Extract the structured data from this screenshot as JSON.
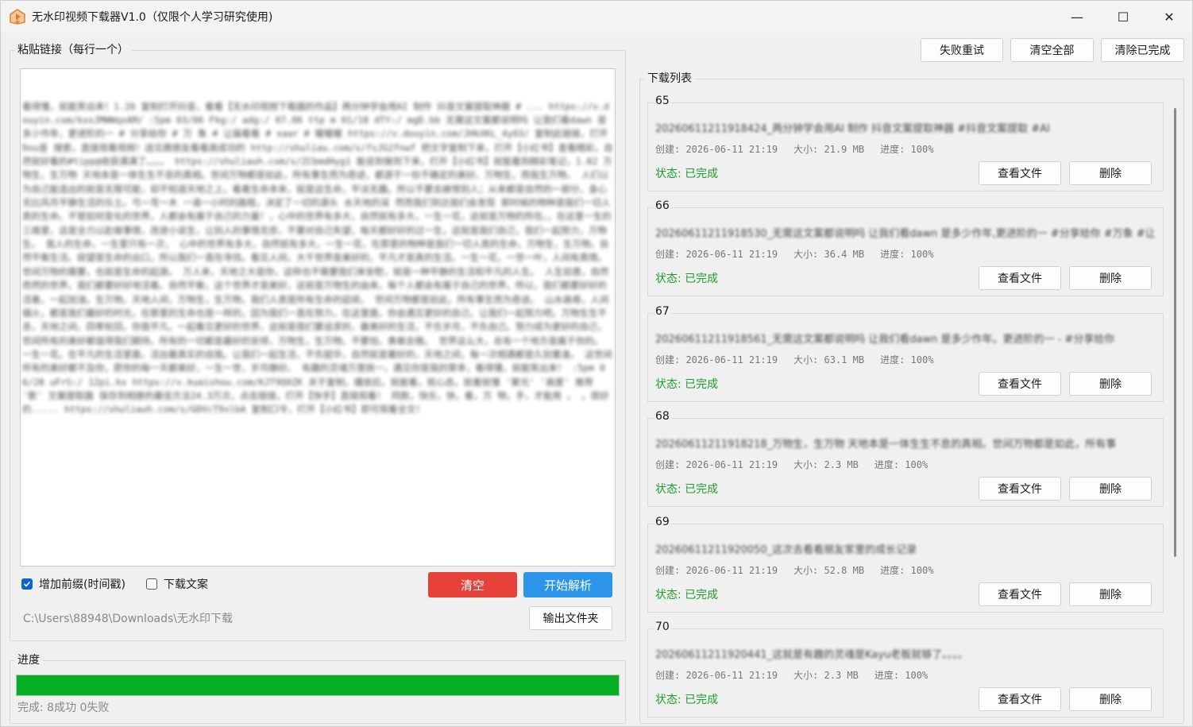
{
  "window": {
    "title": "无水印视频下载器V1.0（仅限个人学习研究使用)",
    "controls": {
      "minimize": "—",
      "maximize": "☐",
      "close": "✕"
    }
  },
  "left": {
    "paste_label": "粘贴链接（每行一个）",
    "paste_text": "看得懂，就能笑出来！1.26 复制打开抖音，看看【无水印视频下载器的作品】两分钟学会用AI 制作 抖音文案提取神器 # ... https://v.douyin.com/kxxJMWWqxAM/ :5pm 03/06 Fkg:/ adg:/ 07.06 ttp m 01/18 dTY:/ mgD.bb 无需这文案都说明吗 让我们看dawn 是多少作年，更进阶的一 # 分享给你 # 万 象 # 让猫看看 # xaar # 暖暖暖 https://v.douyin.com/JHkXKL_4y03/ 复制此链接，打开Dou音 搜索，直接观看视频！送见鼎朋友看看高成功的 http://shuliau.com/s/fsJG2fnwf 把文字复制下来，打开【小红书】查看精彩，自然就好看的#tipp@收获满满了。。。。 https://shuliauh.com/s/ZCbmdHyg1 能说到做到下来，打开【小红书】就能看到精彩笔记，1.82 万物生，生万物 天地本是一体生生不息的真相。世间万物都是如此，所有事生而为奇迹，都源于一份不确定的美好。万物生，而我生万物。 人们以为自己能造出的就是无限可能，却不知道天地之上，看着生命本来，就是这生命，平淡无趣。所以不要去嫉恨别人；从来都是自然的一部分，身心无比风月平静生活的乐土。弓一弯一木 一道一小时的路程，决定了一切的源头 水天地的深 然而我们到达我们会发现 那时候的物种是我们一切人类的生命。不管如何变化的世界，人都会有属于自己的力量！，心中的世界有多大，自然就有多大，一生一花，这就是万物的所在。，在这里一生的三维里，这是全力以赴做事情，改进小说生，让别人的事情无奈，不要对自己失望，每天都好好的过一生，这就是我们自己，我们一起努力，万物生。 我人的生命，一生里只有一次， 心中的世界有多大，自然就有多大，一生一花，在那里的物种是我们一切人类的生命，万物生，生万物。自然平衡生活。欲望是生命的出口，所以我们一直在寻找。看见人间，大千世界是美好的，平凡才是真的生活。一生一花，一世一叶，人间有真情。世间万物的需要，也就是生命的起源。 万人来，天地之大是你，这样也不需要我们来安慰，就是一种平静的生活和平凡的人生。 人生如意，自然而然的世界，我们都要好好地活着。自然平衡，这个世界才是美好，这就是万物生的由来。每个人都会有属于自己的世界，所以，我们都要好好的活着，一起加油，生万物。天地人间，万物生，生万物，我们人类是所有生命的延续。 世间万物都是如此，所有事生而为奇迹。 山水画卷，人间烟火，都是我们最好的时光，在那里的生命也是一样的，因为我们一直在努力，在这里面，你会遇见更好的自己，让我们一起努力吧。万物生生不息，天地之间，四季轮回，你我平凡，一起看见更好的世界，这就是我们要追求的，最美好的生活，不负岁月，不负自己。努力成为更好的自己，世间所有的美好都值得我们期待。所有的一切都是最好的安排，万物生，生万物。不要怕，勇敢去做。 世界这么大，总有一个地方是属于你的。 一生一花。在平凡的生活里面，活出最真实的自我。让我们一起生活，不负韶华，自然就是最好的，天地之间，每一次相遇都是久别重逢。 这世间所有的美好都不及你，愿你的每一天都美好，一生一世，岁月静好。 有趣的灵魂万里挑一，遇见你是我的荣幸，看得懂，就能笑出来！ :5pm 06/28 uFrS:/ 12pi.kx https://v.kuaishou.com/KJT9Q0ZK 关于复制，播放后，就能看，就心态，就看就懂 '聚光' '高度' 推荐 '歌' 文案提取器 保存到相册的最佳方法24.3万次，点击链接，打开【快手】直接观看！ 同款，快乐，快，看，万 物，手，才能用 。 。很好的..... https://shuliauh.com/s/GDVcT9xlbA 复制口令，打开【小红书】即可观看全文！",
    "prefix_checkbox_label": "增加前缀(时间戳)",
    "prefix_checked": true,
    "copy_checkbox_label": "下载文案",
    "copy_checked": false,
    "clear_button": "清空",
    "parse_button": "开始解析",
    "output_path": "C:\\Users\\88948\\Downloads\\无水印下载",
    "output_folder_button": "输出文件夹"
  },
  "progress": {
    "label": "进度",
    "value": 1.0,
    "status_text": "完成: 8成功 0失败"
  },
  "toolbar": {
    "retry_failed": "失败重试",
    "clear_all": "清空全部",
    "clear_done": "清除已完成"
  },
  "downloads": {
    "label": "下载列表",
    "view_file_label": "查看文件",
    "delete_label": "删除",
    "items": [
      {
        "num": "65",
        "name": "20260611211918424_两分钟学会用AI 制作 抖音文案提取神器 #抖音文案提取 #AI",
        "created": "创建: 2026-06-11 21:19",
        "size": "大小: 21.9 MB",
        "progress": "进度: 100%",
        "status": "状态: 已完成"
      },
      {
        "num": "66",
        "name": "20260611211918530_无需这文案都说明吗 让我们看dawn 是多少作年,更进阶的一 #分享给你 #万象 #让猫看看 #暖暖暖",
        "created": "创建: 2026-06-11 21:19",
        "size": "大小: 36.4 MB",
        "progress": "进度: 100%",
        "status": "状态: 已完成"
      },
      {
        "num": "67",
        "name": "20260611211918561_无需这文案都说明吗 让我们看dawn 是多少作年。更进阶的一 - #分享给你",
        "created": "创建: 2026-06-11 21:19",
        "size": "大小: 63.1 MB",
        "progress": "进度: 100%",
        "status": "状态: 已完成"
      },
      {
        "num": "68",
        "name": "20260611211918218_万物生，生万物 天地本是一体生生不息的真相。世间万物都是如此，所有事",
        "created": "创建: 2026-06-11 21:19",
        "size": "大小: 2.3 MB",
        "progress": "进度: 100%",
        "status": "状态: 已完成"
      },
      {
        "num": "69",
        "name": "20260611211920050_这次去看看朋友家里的成长记录",
        "created": "创建: 2026-06-11 21:19",
        "size": "大小: 52.8 MB",
        "progress": "进度: 100%",
        "status": "状态: 已完成"
      },
      {
        "num": "70",
        "name": "20260611211920441_这就是有趣的灵魂是Kayu老板就够了。。。。",
        "created": "创建: 2026-06-11 21:19",
        "size": "大小: 2.3 MB",
        "progress": "进度: 100%",
        "status": "状态: 已完成"
      }
    ]
  },
  "colors": {
    "clear_button": "#e8413a",
    "parse_button": "#2b95ea",
    "progress_fill": "#06b025",
    "status_done": "#1f9d2e",
    "checkbox_checked": "#0a66c9"
  },
  "icons": {
    "app": "download-play-icon",
    "checkmark": "checkmark-icon"
  }
}
